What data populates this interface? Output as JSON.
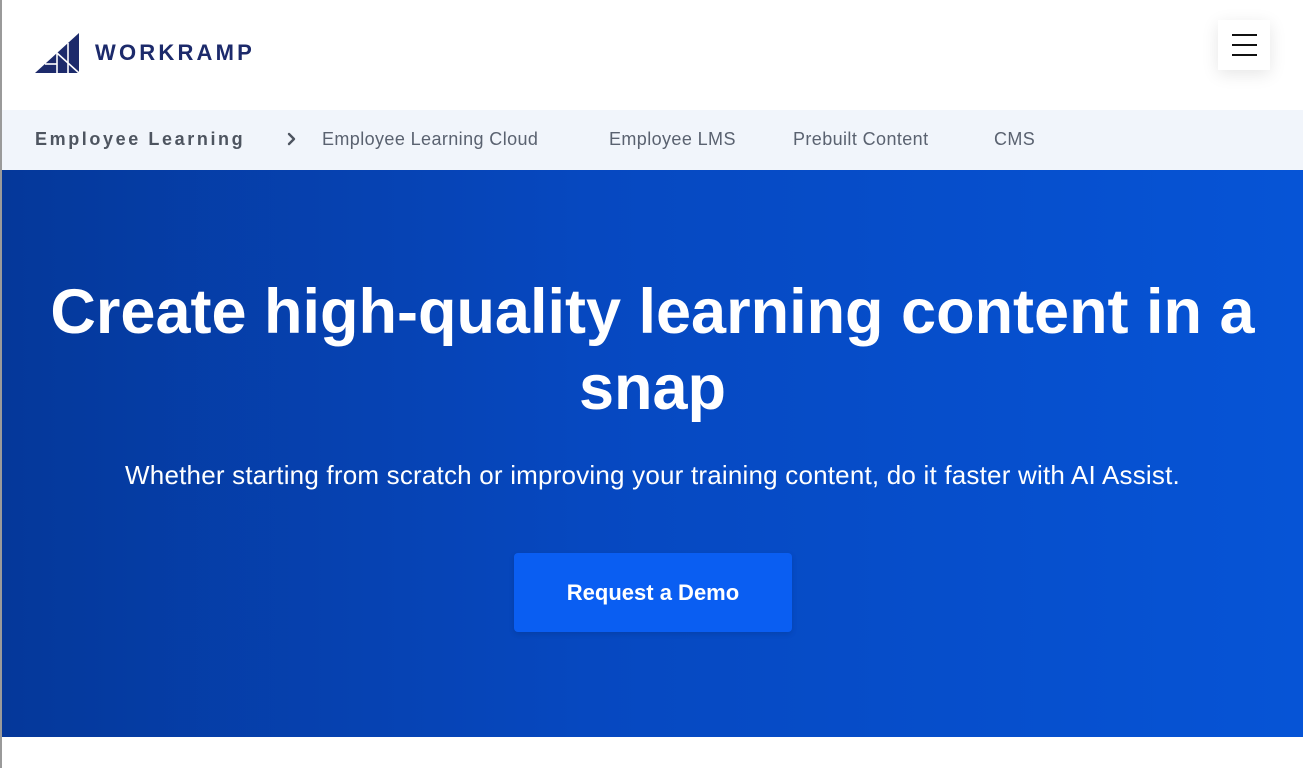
{
  "header": {
    "brand": "WORKRAMP",
    "logo_color": "#1c2a6b",
    "menu_icon": "hamburger-icon"
  },
  "subnav": {
    "section_label": "Employee Learning",
    "separator_icon": "chevron-right-icon",
    "links": [
      {
        "label": "Employee Learning Cloud"
      },
      {
        "label": "Employee LMS"
      },
      {
        "label": "Prebuilt Content"
      },
      {
        "label": "CMS"
      }
    ],
    "background": "#f1f5fb"
  },
  "hero": {
    "title_line1": "Create high-quality learning content in a",
    "title_line2": "snap",
    "subtitle": "Whether starting from scratch or improving your training content, do it faster with AI Assist.",
    "cta_label": "Request a Demo",
    "gradient_start": "#05389a",
    "gradient_end": "#0654d6",
    "cta_color": "#0a5ef2"
  }
}
